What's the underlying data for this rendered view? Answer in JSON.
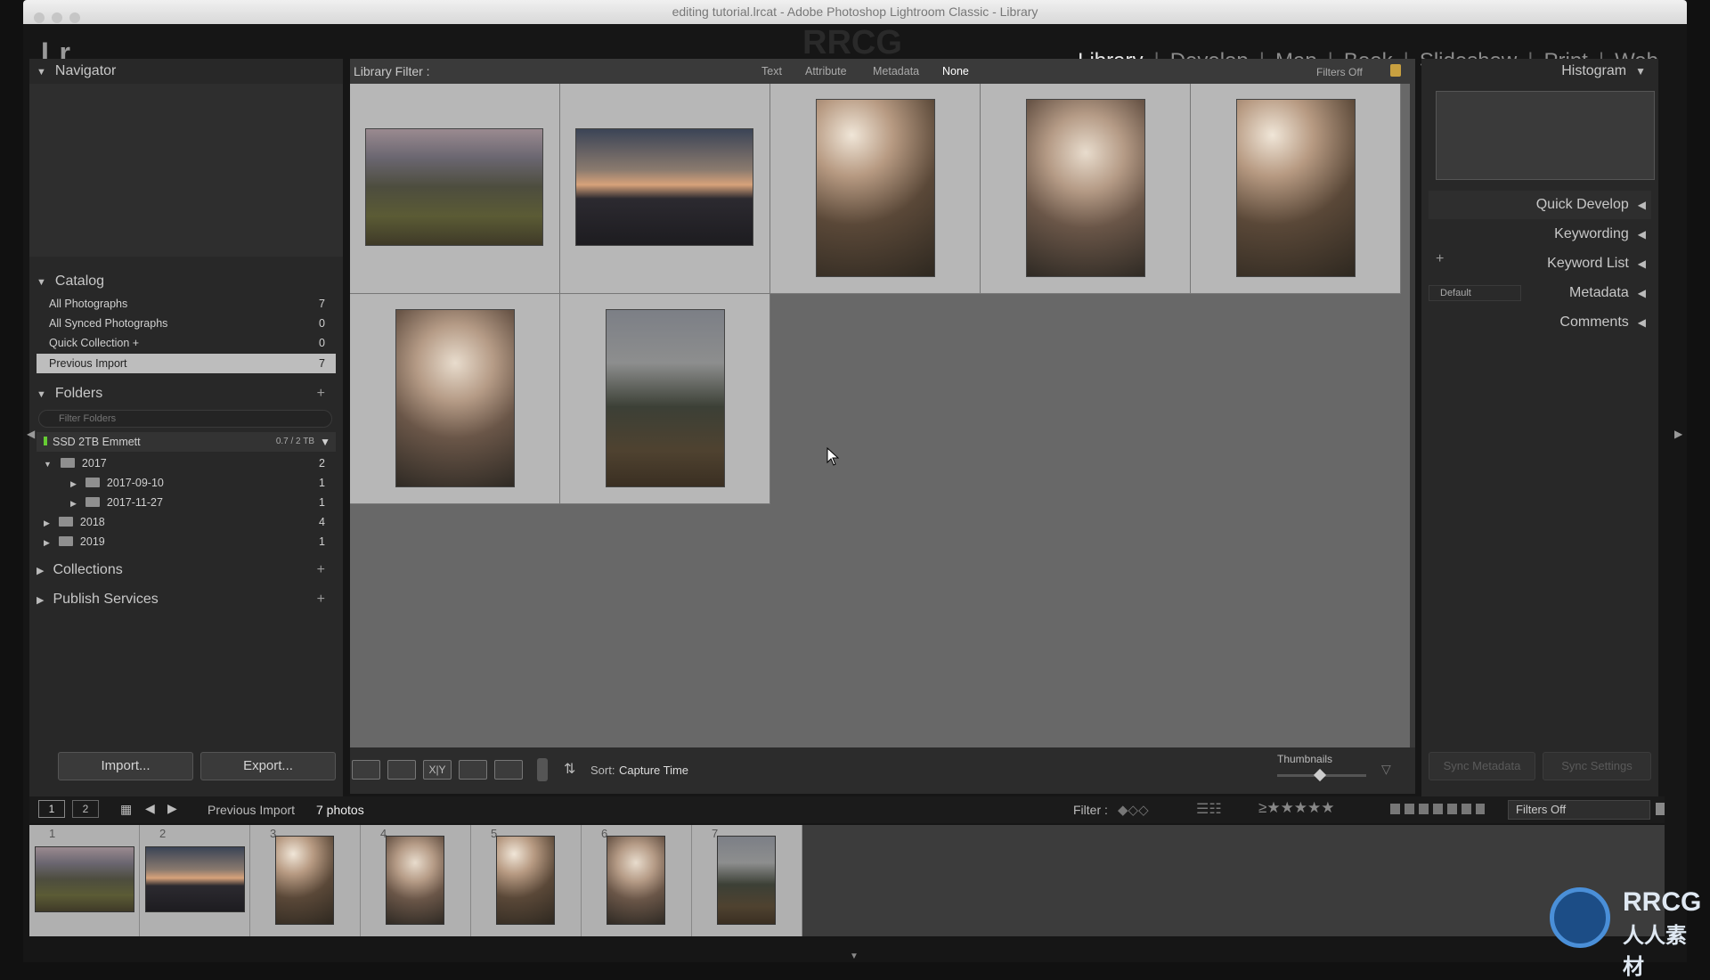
{
  "window": {
    "title": "editing tutorial.lrcat - Adobe Photoshop Lightroom Classic - Library"
  },
  "app": {
    "logo": "Lr",
    "brand_watermark": "RRCG"
  },
  "modules": [
    {
      "label": "Library",
      "active": true
    },
    {
      "label": "Develop"
    },
    {
      "label": "Map"
    },
    {
      "label": "Book"
    },
    {
      "label": "Slideshow"
    },
    {
      "label": "Print"
    },
    {
      "label": "Web"
    }
  ],
  "left_panel": {
    "navigator": {
      "label": "Navigator"
    },
    "catalog": {
      "label": "Catalog",
      "items": [
        {
          "label": "All Photographs",
          "count": "7"
        },
        {
          "label": "All Synced Photographs",
          "count": "0"
        },
        {
          "label": "Quick Collection +",
          "count": "0"
        },
        {
          "label": "Previous Import",
          "count": "7",
          "selected": true
        }
      ]
    },
    "folders": {
      "label": "Folders",
      "filter_placeholder": "Filter Folders",
      "volume": {
        "name": "SSD 2TB Emmett",
        "usage": "0.7 / 2 TB"
      },
      "tree": [
        {
          "name": "2017",
          "count": "2"
        },
        {
          "name": "2017-09-10",
          "count": "1"
        },
        {
          "name": "2017-11-27",
          "count": "1"
        },
        {
          "name": "2018",
          "count": "4"
        },
        {
          "name": "2019",
          "count": "1"
        }
      ]
    },
    "collections": {
      "label": "Collections"
    },
    "publish": {
      "label": "Publish Services"
    },
    "import_label": "Import...",
    "export_label": "Export..."
  },
  "filter_bar": {
    "label": "Library Filter :",
    "tabs": [
      "Text",
      "Attribute",
      "Metadata",
      "None"
    ],
    "active_tab": "None",
    "filters_off": "Filters Off"
  },
  "grid": {
    "photos": [
      {
        "id": 1,
        "subject": "mountain-ruins",
        "style": "g-machu"
      },
      {
        "id": 2,
        "subject": "pagoda-sunset",
        "style": "g-pagoda"
      },
      {
        "id": 3,
        "subject": "woman-portrait",
        "style": "g-woman"
      },
      {
        "id": 4,
        "subject": "woman-portrait",
        "style": "g-woman2"
      },
      {
        "id": 5,
        "subject": "woman-portrait",
        "style": "g-woman"
      },
      {
        "id": 6,
        "subject": "woman-portrait",
        "style": "g-woman2"
      },
      {
        "id": 7,
        "subject": "forest-mountain",
        "style": "g-forest"
      }
    ]
  },
  "toolbar": {
    "sort_label": "Sort:",
    "sort_value": "Capture Time",
    "thumbnails_label": "Thumbnails"
  },
  "right_panel": {
    "histogram": "Histogram",
    "quick_develop": "Quick Develop",
    "keywording": "Keywording",
    "keyword_list": "Keyword List",
    "metadata": "Metadata",
    "metadata_preset": "Default",
    "comments": "Comments",
    "sync_metadata": "Sync Metadata",
    "sync_settings": "Sync Settings"
  },
  "filmstrip_bar": {
    "source": "Previous Import",
    "count": "7 photos",
    "filter_label": "Filter :",
    "filters_off": "Filters Off"
  },
  "filmstrip": {
    "numbers": [
      "1",
      "2",
      "3",
      "4",
      "5",
      "6",
      "7"
    ]
  },
  "watermark": {
    "line1": "RRCG",
    "line2": "人人素材"
  }
}
